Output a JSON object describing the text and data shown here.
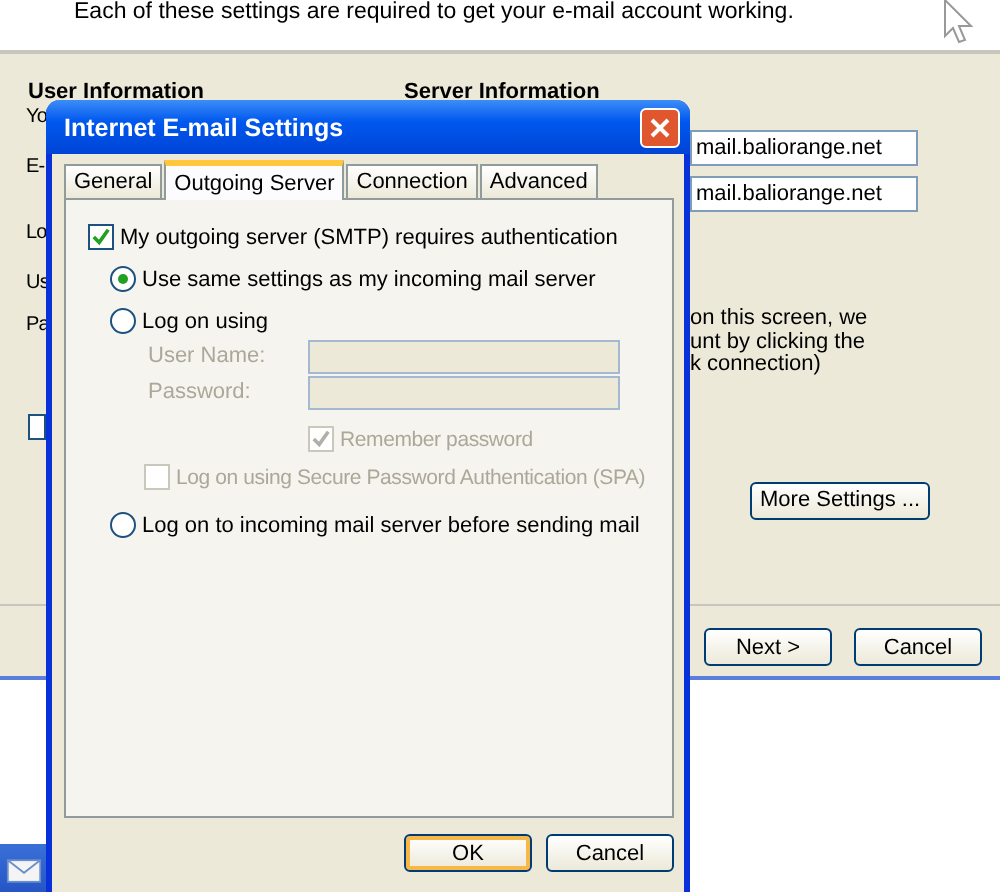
{
  "wizard": {
    "instruction": "Each of these settings are required to get your e-mail account working.",
    "user_heading": "User Information",
    "server_heading": "Server Information",
    "left_fragments": [
      "Yo",
      "E-",
      "Lo",
      "Us",
      "Pa"
    ],
    "server_fields": [
      "mail.baliorange.net",
      "mail.baliorange.net"
    ],
    "note_lines": [
      "on this screen, we",
      "unt by clicking the",
      "k connection)"
    ],
    "checkbox": {
      "checked": false
    },
    "more_settings": "More Settings ...",
    "buttons": [
      "Next >",
      "Cancel"
    ]
  },
  "dialog": {
    "title": "Internet E-mail Settings",
    "tabs": [
      {
        "label": "General",
        "selected": false
      },
      {
        "label": "Outgoing Server",
        "selected": true
      },
      {
        "label": "Connection",
        "selected": false
      },
      {
        "label": "Advanced",
        "selected": false
      }
    ],
    "smtp_auth": {
      "label": "My outgoing server (SMTP) requires authentication",
      "checked": true
    },
    "options": [
      {
        "kind": "radio",
        "label": "Use same settings as my incoming mail server",
        "selected": true
      },
      {
        "kind": "radio",
        "label": "Log on using",
        "selected": false
      },
      {
        "kind": "field",
        "label": "User Name:",
        "disabled": true
      },
      {
        "kind": "field",
        "label": "Password:",
        "disabled": true
      },
      {
        "kind": "checkbox",
        "label": "Remember password",
        "checked": true,
        "disabled": true
      },
      {
        "kind": "checkbox",
        "label": "Log on using Secure Password Authentication (SPA)",
        "checked": false,
        "disabled": true
      },
      {
        "kind": "radio",
        "label": "Log on to incoming mail server before sending mail",
        "selected": false
      }
    ],
    "buttons": [
      "OK",
      "Cancel"
    ]
  }
}
